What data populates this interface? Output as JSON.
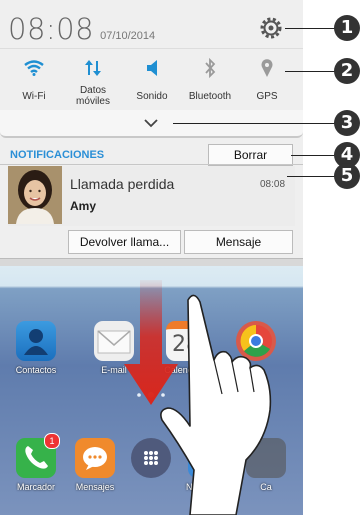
{
  "status": {
    "time": "08:08",
    "date": "07/10/2014"
  },
  "toggles": [
    {
      "label": "Wi-Fi",
      "icon": "wifi-icon",
      "active": true
    },
    {
      "label": "Datos móviles",
      "icon": "mobile-data-icon",
      "active": true
    },
    {
      "label": "Sonido",
      "icon": "sound-icon",
      "active": true
    },
    {
      "label": "Bluetooth",
      "icon": "bluetooth-icon",
      "active": false
    },
    {
      "label": "GPS",
      "icon": "gps-icon",
      "active": false
    }
  ],
  "notifications": {
    "header": "NOTIFICACIONES",
    "clear_label": "Borrar",
    "item": {
      "title": "Llamada perdida",
      "time": "08:08",
      "contact": "Amy",
      "actions": [
        "Devolver llama...",
        "Mensaje"
      ]
    }
  },
  "home": {
    "row1": [
      "Contactos",
      "E-mail",
      "Calendario",
      ""
    ],
    "calendar_day": "28",
    "dock": [
      "Marcador",
      "Mensajes",
      "",
      "Navegador",
      "Ca"
    ],
    "phone_badge": "1"
  },
  "callouts": [
    "1",
    "2",
    "3",
    "4",
    "5"
  ],
  "colors": {
    "accent": "#2b8fd6",
    "toggle_active": "#1f8fd2",
    "toggle_inactive": "#9a9a9a",
    "arrow": "#d9261c"
  }
}
